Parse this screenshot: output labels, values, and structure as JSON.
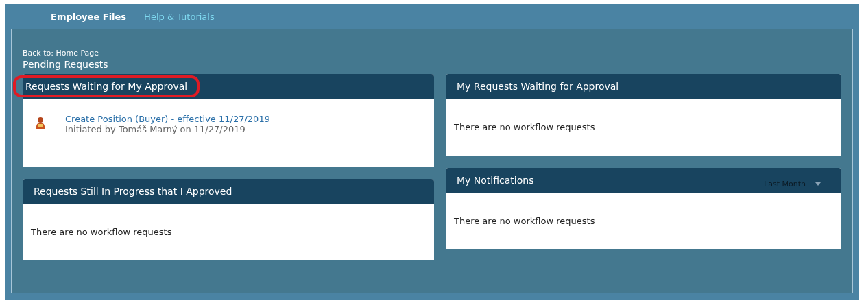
{
  "top_nav": [
    {
      "label": "Employee Files",
      "selected": true
    },
    {
      "label": "Help & Tutorials",
      "selected": false
    }
  ],
  "breadcrumb": "Back to: Home Page",
  "page_title": "Pending Requests",
  "columns": [
    [
      {
        "title": "Requests Waiting for My Approval",
        "highlighted": true,
        "items": [
          {
            "title": "Create Position (Buyer) - effective 11/27/2019",
            "subtitle": "Initiated by Tomáš Marný on 11/27/2019"
          }
        ]
      },
      {
        "title": "Requests Still In Progress that I Approved",
        "highlighted": false,
        "empty_text": "There are no workflow requests"
      }
    ],
    [
      {
        "title": "My Requests Waiting for Approval",
        "highlighted": false,
        "empty_text": "There are no workflow requests"
      },
      {
        "title": "My Notifications",
        "highlighted": false,
        "filter": "Last Month",
        "empty_text": "There are no workflow requests"
      }
    ]
  ]
}
